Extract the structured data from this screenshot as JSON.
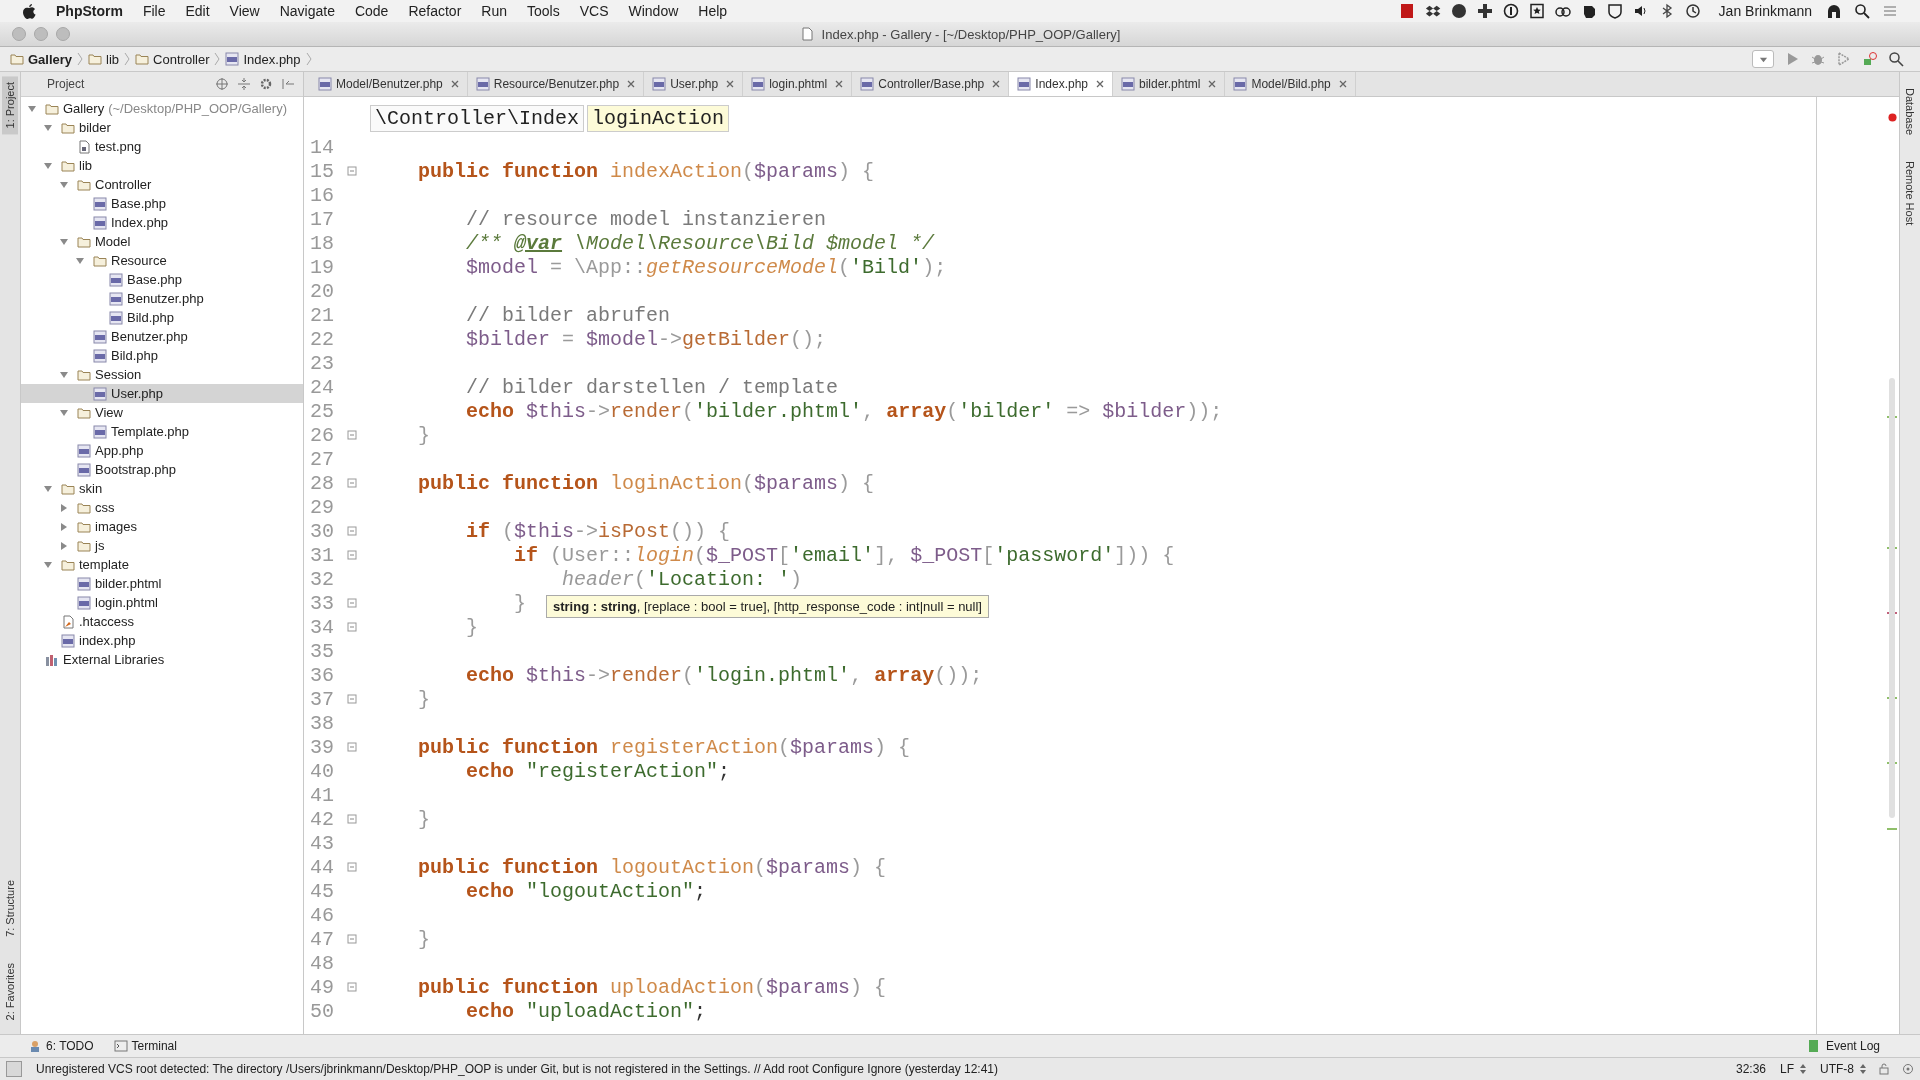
{
  "menu_bar": {
    "app": "PhpStorm",
    "items": [
      "File",
      "Edit",
      "View",
      "Navigate",
      "Code",
      "Refactor",
      "Run",
      "Tools",
      "VCS",
      "Window",
      "Help"
    ],
    "user": "Jan Brinkmann"
  },
  "window": {
    "title": "Index.php - Gallery - [~/Desktop/PHP_OOP/Gallery]"
  },
  "nav_bar": [
    "Gallery",
    "lib",
    "Controller",
    "Index.php"
  ],
  "side_tools_left": [
    {
      "label": "1: Project",
      "selected": true
    },
    {
      "label": "7: Structure",
      "selected": false
    },
    {
      "label": "2: Favorites",
      "selected": false
    }
  ],
  "side_tools_right": [
    "Database",
    "Remote Host"
  ],
  "project_panel": {
    "title": "Project",
    "tree": [
      {
        "label": "Gallery",
        "path": "(~/Desktop/PHP_OOP/Gallery)",
        "kind": "folder",
        "expanded": true,
        "selected": false,
        "children": [
          {
            "label": "bilder",
            "kind": "folder",
            "expanded": true,
            "selected": false,
            "children": [
              {
                "label": "test.png",
                "kind": "image",
                "selected": false
              }
            ]
          },
          {
            "label": "lib",
            "kind": "folder",
            "expanded": true,
            "selected": false,
            "children": [
              {
                "label": "Controller",
                "kind": "folder",
                "expanded": true,
                "selected": false,
                "children": [
                  {
                    "label": "Base.php",
                    "kind": "php",
                    "selected": false
                  },
                  {
                    "label": "Index.php",
                    "kind": "php",
                    "selected": false
                  }
                ]
              },
              {
                "label": "Model",
                "kind": "folder",
                "expanded": true,
                "selected": false,
                "children": [
                  {
                    "label": "Resource",
                    "kind": "folder",
                    "expanded": true,
                    "selected": false,
                    "children": [
                      {
                        "label": "Base.php",
                        "kind": "php",
                        "selected": false
                      },
                      {
                        "label": "Benutzer.php",
                        "kind": "php",
                        "selected": false
                      },
                      {
                        "label": "Bild.php",
                        "kind": "php",
                        "selected": false
                      }
                    ]
                  },
                  {
                    "label": "Benutzer.php",
                    "kind": "php",
                    "selected": false
                  },
                  {
                    "label": "Bild.php",
                    "kind": "php",
                    "selected": false
                  }
                ]
              },
              {
                "label": "Session",
                "kind": "folder",
                "expanded": true,
                "selected": false,
                "children": [
                  {
                    "label": "User.php",
                    "kind": "php",
                    "selected": true
                  }
                ]
              },
              {
                "label": "View",
                "kind": "folder",
                "expanded": true,
                "selected": false,
                "children": [
                  {
                    "label": "Template.php",
                    "kind": "php",
                    "selected": false
                  }
                ]
              },
              {
                "label": "App.php",
                "kind": "php",
                "selected": false
              },
              {
                "label": "Bootstrap.php",
                "kind": "php",
                "selected": false
              }
            ]
          },
          {
            "label": "skin",
            "kind": "folder",
            "expanded": true,
            "selected": false,
            "children": [
              {
                "label": "css",
                "kind": "folder",
                "expanded": false,
                "selected": false
              },
              {
                "label": "images",
                "kind": "folder",
                "expanded": false,
                "selected": false
              },
              {
                "label": "js",
                "kind": "folder",
                "expanded": false,
                "selected": false
              }
            ]
          },
          {
            "label": "template",
            "kind": "folder",
            "expanded": true,
            "selected": false,
            "children": [
              {
                "label": "bilder.phtml",
                "kind": "php",
                "selected": false
              },
              {
                "label": "login.phtml",
                "kind": "php",
                "selected": false
              }
            ]
          },
          {
            "label": ".htaccess",
            "kind": "config",
            "selected": false
          },
          {
            "label": "index.php",
            "kind": "php",
            "selected": false
          }
        ]
      },
      {
        "label": "External Libraries",
        "kind": "library",
        "selected": false
      }
    ]
  },
  "tabs": [
    {
      "label": "Model/Benutzer.php",
      "selected": false
    },
    {
      "label": "Resource/Benutzer.php",
      "selected": false
    },
    {
      "label": "User.php",
      "selected": false
    },
    {
      "label": "login.phtml",
      "selected": false
    },
    {
      "label": "Controller/Base.php",
      "selected": false
    },
    {
      "label": "Index.php",
      "selected": true
    },
    {
      "label": "bilder.phtml",
      "selected": false
    },
    {
      "label": "Model/Bild.php",
      "selected": false
    }
  ],
  "breadcrumb": [
    "\\Controller\\Index",
    "loginAction"
  ],
  "code": [
    {
      "number": "14",
      "fold": false
    },
    {
      "number": "15",
      "fold": true,
      "tokens": [
        {
          "kind": "kw",
          "text": "    public function "
        },
        {
          "kind": "fn",
          "text": "indexAction"
        },
        {
          "kind": "punc",
          "text": "("
        },
        {
          "kind": "var",
          "text": "$params"
        },
        {
          "kind": "punc",
          "text": ") {"
        }
      ]
    },
    {
      "number": "16",
      "fold": false
    },
    {
      "number": "17",
      "fold": false,
      "tokens": [
        {
          "kind": "cmt",
          "text": "        // resource model instanzieren"
        }
      ]
    },
    {
      "number": "18",
      "fold": false,
      "tokens": [
        {
          "kind": "doc",
          "text": "        /** "
        },
        {
          "kind": "doctag",
          "text": "@var"
        },
        {
          "kind": "doc",
          "text": " \\Model\\Resource\\Bild $model */"
        }
      ]
    },
    {
      "number": "19",
      "fold": false,
      "tokens": [
        {
          "kind": "var",
          "text": "        $model"
        },
        {
          "kind": "punc",
          "text": " = \\App::"
        },
        {
          "kind": "static",
          "text": "getResourceModel"
        },
        {
          "kind": "punc",
          "text": "("
        },
        {
          "kind": "str",
          "text": "'Bild'"
        },
        {
          "kind": "punc",
          "text": ");"
        }
      ]
    },
    {
      "number": "20",
      "fold": false
    },
    {
      "number": "21",
      "fold": false,
      "tokens": [
        {
          "kind": "cmt",
          "text": "        // bilder abrufen"
        }
      ]
    },
    {
      "number": "22",
      "fold": false,
      "tokens": [
        {
          "kind": "var",
          "text": "        $bilder"
        },
        {
          "kind": "punc",
          "text": " = "
        },
        {
          "kind": "var",
          "text": "$model"
        },
        {
          "kind": "punc",
          "text": "->"
        },
        {
          "kind": "method",
          "text": "getBilder"
        },
        {
          "kind": "punc",
          "text": "();"
        }
      ]
    },
    {
      "number": "23",
      "fold": false
    },
    {
      "number": "24",
      "fold": false,
      "tokens": [
        {
          "kind": "cmt",
          "text": "        // bilder darstellen / template"
        }
      ]
    },
    {
      "number": "25",
      "fold": false,
      "tokens": [
        {
          "kind": "kw",
          "text": "        echo "
        },
        {
          "kind": "var",
          "text": "$this"
        },
        {
          "kind": "punc",
          "text": "->"
        },
        {
          "kind": "method",
          "text": "render"
        },
        {
          "kind": "punc",
          "text": "("
        },
        {
          "kind": "str",
          "text": "'bilder.phtml'"
        },
        {
          "kind": "punc",
          "text": ", "
        },
        {
          "kind": "kw",
          "text": "array"
        },
        {
          "kind": "punc",
          "text": "("
        },
        {
          "kind": "str",
          "text": "'bilder'"
        },
        {
          "kind": "punc",
          "text": " => "
        },
        {
          "kind": "var",
          "text": "$bilder"
        },
        {
          "kind": "punc",
          "text": "));"
        }
      ]
    },
    {
      "number": "26",
      "fold": true,
      "tokens": [
        {
          "kind": "punc",
          "text": "    }"
        }
      ]
    },
    {
      "number": "27",
      "fold": false
    },
    {
      "number": "28",
      "fold": true,
      "tokens": [
        {
          "kind": "kw",
          "text": "    public function "
        },
        {
          "kind": "fn",
          "text": "loginAction"
        },
        {
          "kind": "punc",
          "text": "("
        },
        {
          "kind": "var",
          "text": "$params"
        },
        {
          "kind": "punc",
          "text": ") {"
        }
      ]
    },
    {
      "number": "29",
      "fold": false
    },
    {
      "number": "30",
      "fold": true,
      "tokens": [
        {
          "kind": "kw",
          "text": "        if "
        },
        {
          "kind": "punc",
          "text": "("
        },
        {
          "kind": "var",
          "text": "$this"
        },
        {
          "kind": "punc",
          "text": "->"
        },
        {
          "kind": "method",
          "text": "isPost"
        },
        {
          "kind": "punc",
          "text": "()) {"
        }
      ]
    },
    {
      "number": "31",
      "fold": true,
      "tokens": [
        {
          "kind": "kw",
          "text": "            if "
        },
        {
          "kind": "punc",
          "text": "(User::"
        },
        {
          "kind": "static",
          "text": "login"
        },
        {
          "kind": "punc",
          "text": "("
        },
        {
          "kind": "var",
          "text": "$_POST"
        },
        {
          "kind": "punc",
          "text": "["
        },
        {
          "kind": "str",
          "text": "'email'"
        },
        {
          "kind": "punc",
          "text": "], "
        },
        {
          "kind": "var",
          "text": "$_POST"
        },
        {
          "kind": "punc",
          "text": "["
        },
        {
          "kind": "str",
          "text": "'password'"
        },
        {
          "kind": "punc",
          "text": "])) {"
        }
      ]
    },
    {
      "number": "32",
      "fold": false,
      "tokens": [
        {
          "kind": "ghost",
          "text": "                header"
        },
        {
          "kind": "punc",
          "text": "("
        },
        {
          "kind": "str",
          "text": "'Location: '"
        },
        {
          "kind": "punc",
          "text": ")"
        }
      ]
    },
    {
      "number": "33",
      "fold": true,
      "tokens": [
        {
          "kind": "punc",
          "text": "            }"
        }
      ]
    },
    {
      "number": "34",
      "fold": true,
      "tokens": [
        {
          "kind": "punc",
          "text": "        }"
        }
      ]
    },
    {
      "number": "35",
      "fold": false
    },
    {
      "number": "36",
      "fold": false,
      "tokens": [
        {
          "kind": "kw",
          "text": "        echo "
        },
        {
          "kind": "var",
          "text": "$this"
        },
        {
          "kind": "punc",
          "text": "->"
        },
        {
          "kind": "method",
          "text": "render"
        },
        {
          "kind": "punc",
          "text": "("
        },
        {
          "kind": "str",
          "text": "'login.phtml'"
        },
        {
          "kind": "punc",
          "text": ", "
        },
        {
          "kind": "kw",
          "text": "array"
        },
        {
          "kind": "punc",
          "text": "());"
        }
      ]
    },
    {
      "number": "37",
      "fold": true,
      "tokens": [
        {
          "kind": "punc",
          "text": "    }"
        }
      ]
    },
    {
      "number": "38",
      "fold": false
    },
    {
      "number": "39",
      "fold": true,
      "tokens": [
        {
          "kind": "kw",
          "text": "    public function "
        },
        {
          "kind": "fn",
          "text": "registerAction"
        },
        {
          "kind": "punc",
          "text": "("
        },
        {
          "kind": "var",
          "text": "$params"
        },
        {
          "kind": "punc",
          "text": ") {"
        }
      ]
    },
    {
      "number": "40",
      "fold": false,
      "tokens": [
        {
          "kind": "kw",
          "text": "        echo "
        },
        {
          "kind": "str",
          "text": "\"registerAction\""
        },
        {
          "kind": "plain",
          "text": ";"
        }
      ]
    },
    {
      "number": "41",
      "fold": false
    },
    {
      "number": "42",
      "fold": true,
      "tokens": [
        {
          "kind": "punc",
          "text": "    }"
        }
      ]
    },
    {
      "number": "43",
      "fold": false
    },
    {
      "number": "44",
      "fold": true,
      "tokens": [
        {
          "kind": "kw",
          "text": "    public function "
        },
        {
          "kind": "fn",
          "text": "logoutAction"
        },
        {
          "kind": "punc",
          "text": "("
        },
        {
          "kind": "var",
          "text": "$params"
        },
        {
          "kind": "punc",
          "text": ") {"
        }
      ]
    },
    {
      "number": "45",
      "fold": false,
      "tokens": [
        {
          "kind": "kw",
          "text": "        echo "
        },
        {
          "kind": "str",
          "text": "\"logoutAction\""
        },
        {
          "kind": "plain",
          "text": ";"
        }
      ]
    },
    {
      "number": "46",
      "fold": false
    },
    {
      "number": "47",
      "fold": true,
      "tokens": [
        {
          "kind": "punc",
          "text": "    }"
        }
      ]
    },
    {
      "number": "48",
      "fold": false
    },
    {
      "number": "49",
      "fold": true,
      "tokens": [
        {
          "kind": "kw",
          "text": "    public function "
        },
        {
          "kind": "fn",
          "text": "uploadAction"
        },
        {
          "kind": "punc",
          "text": "("
        },
        {
          "kind": "var",
          "text": "$params"
        },
        {
          "kind": "punc",
          "text": ") {"
        }
      ]
    },
    {
      "number": "50",
      "fold": false,
      "tokens": [
        {
          "kind": "kw",
          "text": "        echo "
        },
        {
          "kind": "str",
          "text": "\"uploadAction\""
        },
        {
          "kind": "plain",
          "text": ";"
        }
      ]
    }
  ],
  "tooltip": "**string : string**, [replace : bool = true], [http_response_code : int|null = null]",
  "bottom_tools": [
    "6: TODO",
    "Terminal"
  ],
  "event_log": "Event Log",
  "status_bar": {
    "message": "Unregistered VCS root detected: The directory /Users/jbrinkmann/Desktop/PHP_OOP is under Git, but is not registered in the Settings. // Add root  Configure  Ignore (yesterday 12:41)",
    "position": "32:36",
    "line_separator": "LF",
    "encoding": "UTF-8"
  }
}
